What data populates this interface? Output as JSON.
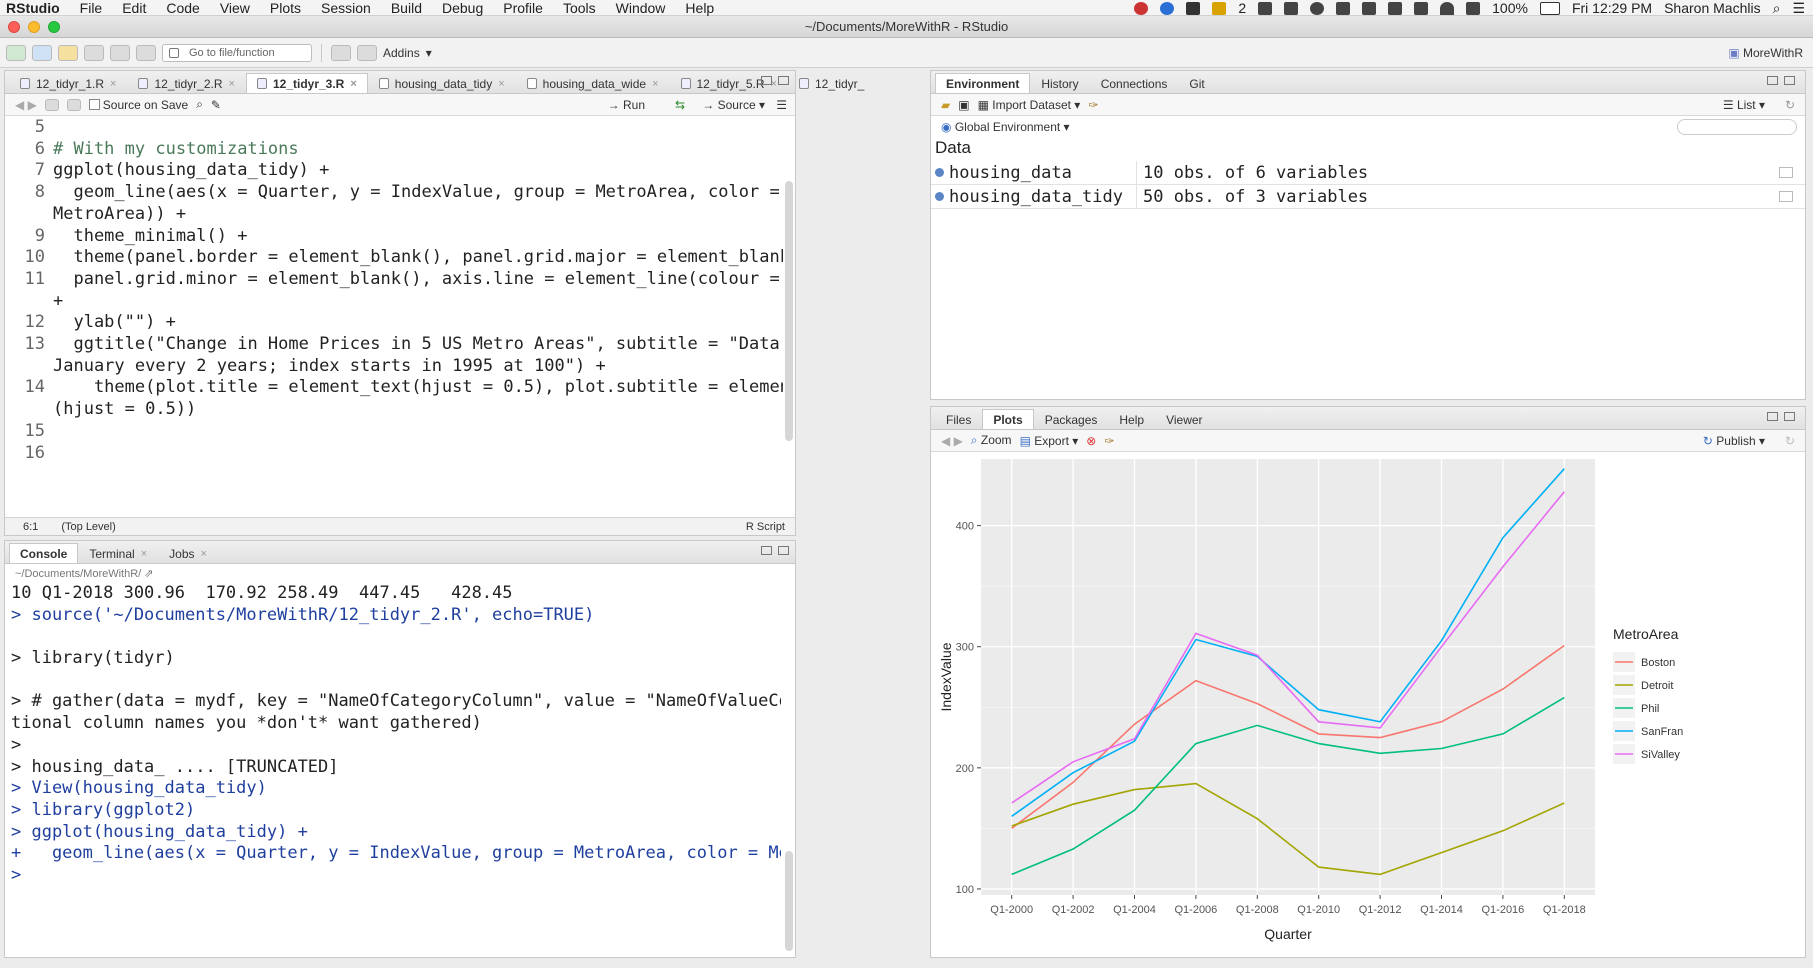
{
  "menubar": {
    "app": "RStudio",
    "items": [
      "File",
      "Edit",
      "Code",
      "View",
      "Plots",
      "Session",
      "Build",
      "Debug",
      "Profile",
      "Tools",
      "Window",
      "Help"
    ],
    "battery": "100%",
    "badge_count": "2",
    "clock": "Fri 12:29 PM",
    "user": "Sharon Machlis"
  },
  "window": {
    "title": "~/Documents/MoreWithR - RStudio"
  },
  "toolbar": {
    "goto_placeholder": "Go to file/function",
    "addins": "Addins",
    "project": "MoreWithR"
  },
  "editor": {
    "tabs": [
      "12_tidyr_1.R",
      "12_tidyr_2.R",
      "12_tidyr_3.R",
      "housing_data_tidy",
      "housing_data_wide",
      "12_tidyr_5.R",
      "12_tidyr_"
    ],
    "active_tab": "12_tidyr_3.R",
    "source_on_save": "Source on Save",
    "run": "Run",
    "source": "Source",
    "status_pos": "6:1",
    "status_scope": "(Top Level)",
    "status_type": "R Script",
    "lines": [
      {
        "n": "5",
        "t": ""
      },
      {
        "n": "6",
        "t": "# With my customizations",
        "c": "cm"
      },
      {
        "n": "7",
        "t": "ggplot(housing_data_tidy) +"
      },
      {
        "n": "8",
        "t": "  geom_line(aes(x = Quarter, y = IndexValue, group = MetroArea, color ="
      },
      {
        "n": "",
        "t": "MetroArea)) +"
      },
      {
        "n": "9",
        "t": "  theme_minimal() +"
      },
      {
        "n": "10",
        "t": "  theme(panel.border = element_blank(), panel.grid.major = element_blank(),"
      },
      {
        "n": "11",
        "t": "  panel.grid.minor = element_blank(), axis.line = element_line(colour = \"gray\"))"
      },
      {
        "n": "",
        "t": "+"
      },
      {
        "n": "12",
        "t": "  ylab(\"\") +"
      },
      {
        "n": "13",
        "t": "  ggtitle(\"Change in Home Prices in 5 US Metro Areas\", subtitle = \"Data measured"
      },
      {
        "n": "",
        "t": "January every 2 years; index starts in 1995 at 100\") +"
      },
      {
        "n": "14",
        "t": "    theme(plot.title = element_text(hjust = 0.5), plot.subtitle = element_text"
      },
      {
        "n": "",
        "t": "(hjust = 0.5))"
      },
      {
        "n": "15",
        "t": ""
      },
      {
        "n": "16",
        "t": ""
      }
    ]
  },
  "console": {
    "tabs": [
      "Console",
      "Terminal",
      "Jobs"
    ],
    "path": "~/Documents/MoreWithR/",
    "lines": [
      {
        "t": "10 Q1-2018 300.96  170.92 258.49  447.45   428.45",
        "c": ""
      },
      {
        "t": "> source('~/Documents/MoreWithR/12_tidyr_2.R', echo=TRUE)",
        "c": "blue"
      },
      {
        "t": "",
        "c": ""
      },
      {
        "t": "> library(tidyr)",
        "c": ""
      },
      {
        "t": "",
        "c": ""
      },
      {
        "t": "> # gather(data = mydf, key = \"NameOfCategoryColumn\", value = \"NameOfValueColumn\", op",
        "c": ""
      },
      {
        "t": "tional column names you *don't* want gathered)",
        "c": ""
      },
      {
        "t": ">",
        "c": ""
      },
      {
        "t": "> housing_data_ .... [TRUNCATED]",
        "c": ""
      },
      {
        "t": "> View(housing_data_tidy)",
        "c": "blue"
      },
      {
        "t": "> library(ggplot2)",
        "c": "blue"
      },
      {
        "t": "> ggplot(housing_data_tidy) +",
        "c": "blue"
      },
      {
        "t": "+   geom_line(aes(x = Quarter, y = IndexValue, group = MetroArea, color = MetroArea))",
        "c": "blue"
      },
      {
        "t": "> ",
        "c": "blue"
      }
    ]
  },
  "environment": {
    "tabs": [
      "Environment",
      "History",
      "Connections",
      "Git"
    ],
    "import_dataset": "Import Dataset",
    "list_view": "List",
    "scope": "Global Environment",
    "section": "Data",
    "rows": [
      {
        "name": "housing_data",
        "value": "10 obs. of 6 variables"
      },
      {
        "name": "housing_data_tidy",
        "value": "50 obs. of 3 variables"
      }
    ]
  },
  "files": {
    "tabs": [
      "Files",
      "Plots",
      "Packages",
      "Help",
      "Viewer"
    ],
    "active_tab": "Plots",
    "zoom": "Zoom",
    "export": "Export",
    "publish": "Publish"
  },
  "chart_data": {
    "type": "line",
    "xlabel": "Quarter",
    "ylabel": "IndexValue",
    "legend_title": "MetroArea",
    "legend_position": "right",
    "ylim": [
      95,
      455
    ],
    "yticks": [
      100,
      200,
      300,
      400
    ],
    "categories": [
      "Q1-2000",
      "Q1-2002",
      "Q1-2004",
      "Q1-2006",
      "Q1-2008",
      "Q1-2010",
      "Q1-2012",
      "Q1-2014",
      "Q1-2016",
      "Q1-2018"
    ],
    "series": [
      {
        "name": "Boston",
        "color": "#F8766D",
        "values": [
          150,
          188,
          236,
          272,
          253,
          228,
          225,
          238,
          265,
          301
        ]
      },
      {
        "name": "Detroit",
        "color": "#A3A500",
        "values": [
          152,
          170,
          182,
          187,
          158,
          118,
          112,
          130,
          148,
          171
        ]
      },
      {
        "name": "Phil",
        "color": "#00BF7D",
        "values": [
          112,
          133,
          165,
          220,
          235,
          220,
          212,
          216,
          228,
          258
        ]
      },
      {
        "name": "SanFran",
        "color": "#00B0F6",
        "values": [
          160,
          196,
          222,
          306,
          292,
          248,
          238,
          305,
          390,
          447
        ]
      },
      {
        "name": "SiValley",
        "color": "#E76BF3",
        "values": [
          171,
          205,
          224,
          311,
          293,
          238,
          233,
          300,
          366,
          428
        ]
      }
    ]
  }
}
